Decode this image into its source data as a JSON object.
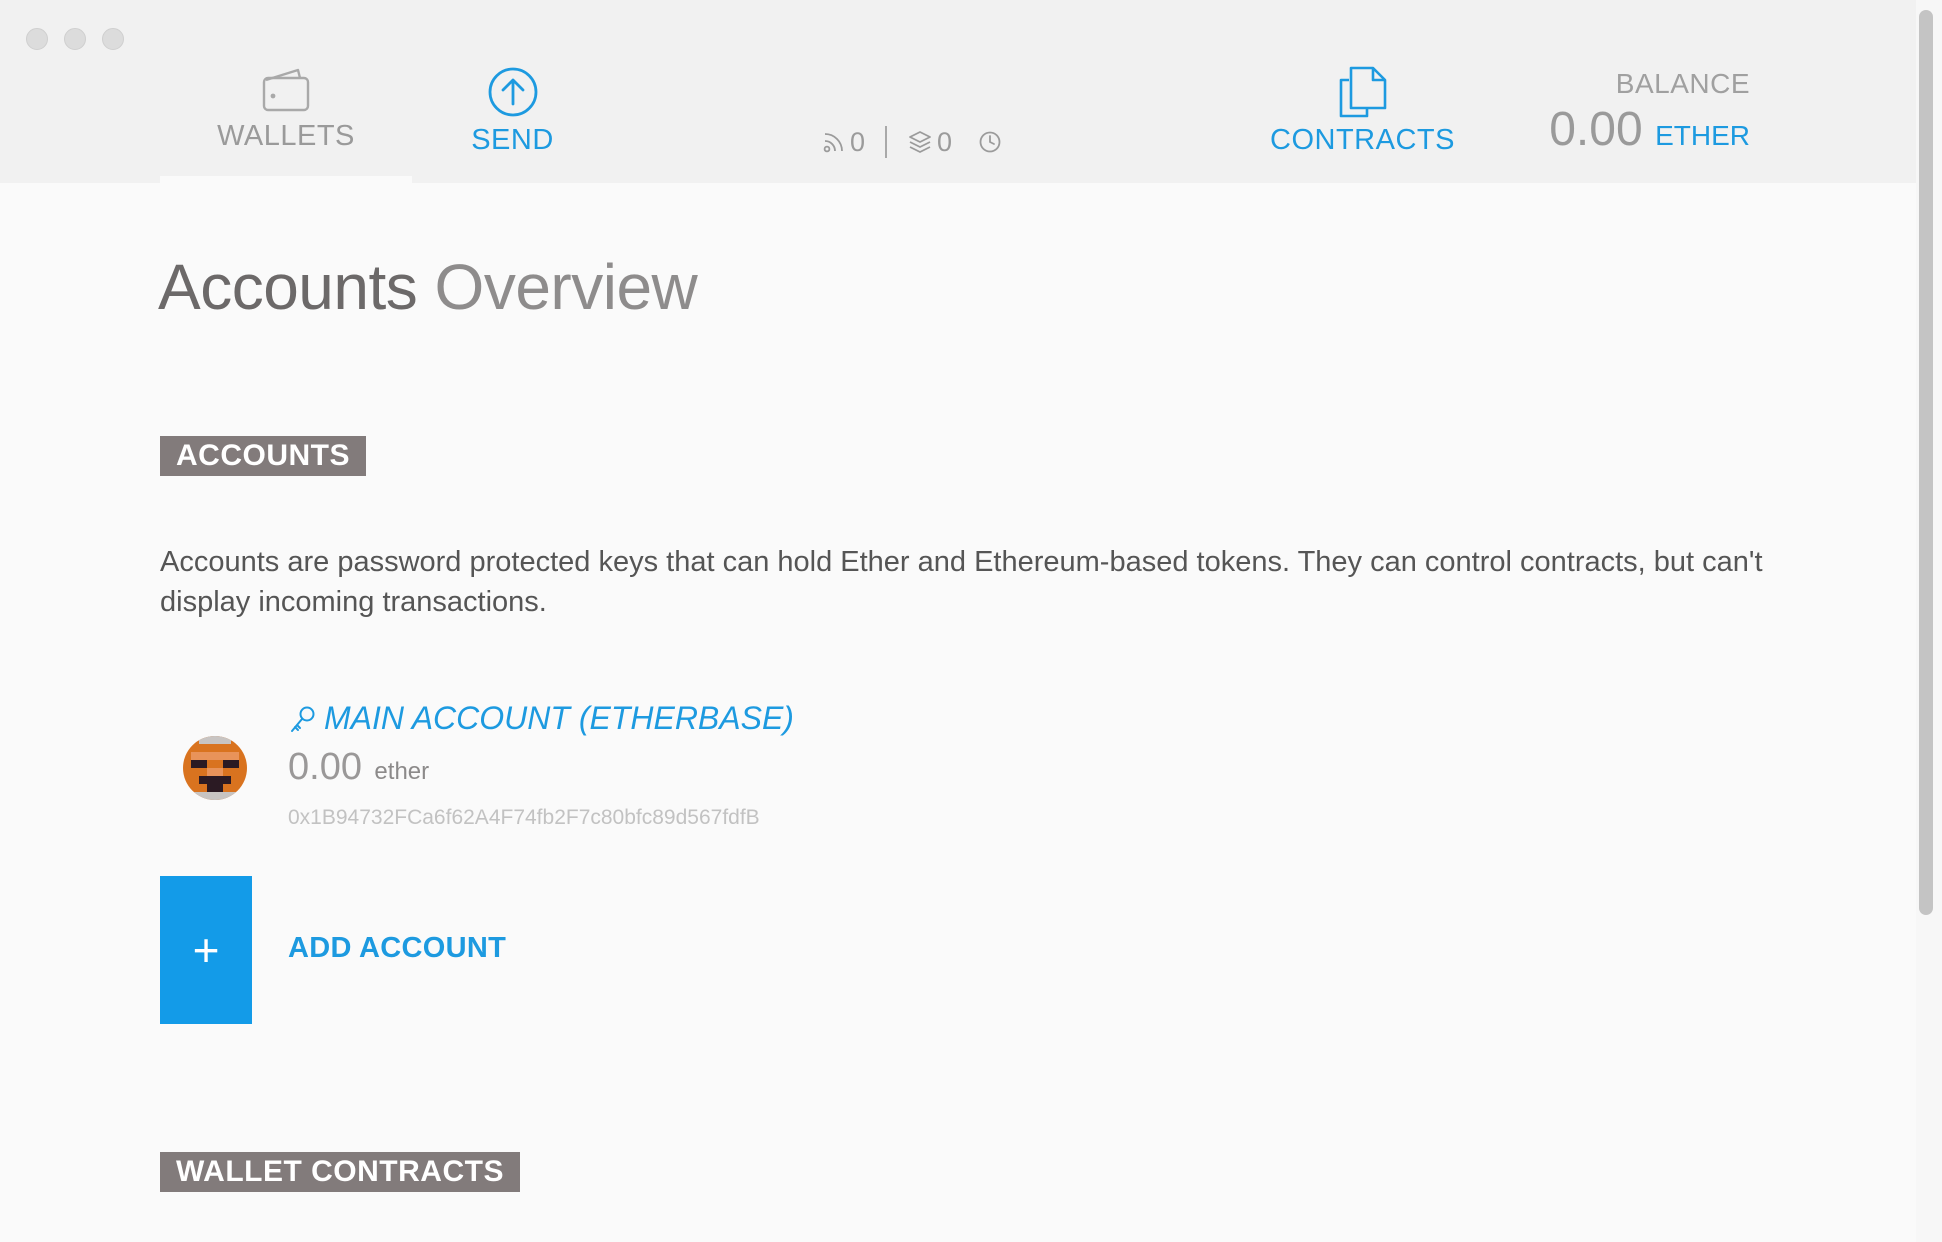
{
  "header": {
    "nav": {
      "wallets": "WALLETS",
      "send": "SEND",
      "contracts": "CONTRACTS"
    },
    "status": {
      "peers": "0",
      "blocks": "0"
    },
    "balance": {
      "title": "BALANCE",
      "amount": "0.00",
      "unit": "ETHER"
    }
  },
  "page": {
    "title_strong": "Accounts",
    "title_light": "Overview"
  },
  "accounts_section": {
    "tag": "ACCOUNTS",
    "description": "Accounts are password protected keys that can hold Ether and Ethereum-based tokens. They can control contracts, but can't display incoming transactions.",
    "items": [
      {
        "name": "MAIN ACCOUNT (ETHERBASE)",
        "balance": "0.00",
        "unit": "ether",
        "address": "0x1B94732FCa6f62A4F74fb2F7c80bfc89d567fdfB"
      }
    ],
    "add_button_symbol": "+",
    "add_label": "ADD ACCOUNT"
  },
  "wallet_contracts_section": {
    "tag": "WALLET CONTRACTS"
  },
  "colors": {
    "accent": "#1d9ae0",
    "add_button": "#139be8",
    "section_tag": "#827b7b",
    "header_bg": "#f1f1f1"
  },
  "icons": {
    "wallets": "wallet-icon",
    "send": "arrow-up-circle-icon",
    "contracts": "documents-icon",
    "peers": "signal-icon",
    "blocks": "layers-icon",
    "clock": "clock-icon",
    "account_key": "key-icon"
  }
}
